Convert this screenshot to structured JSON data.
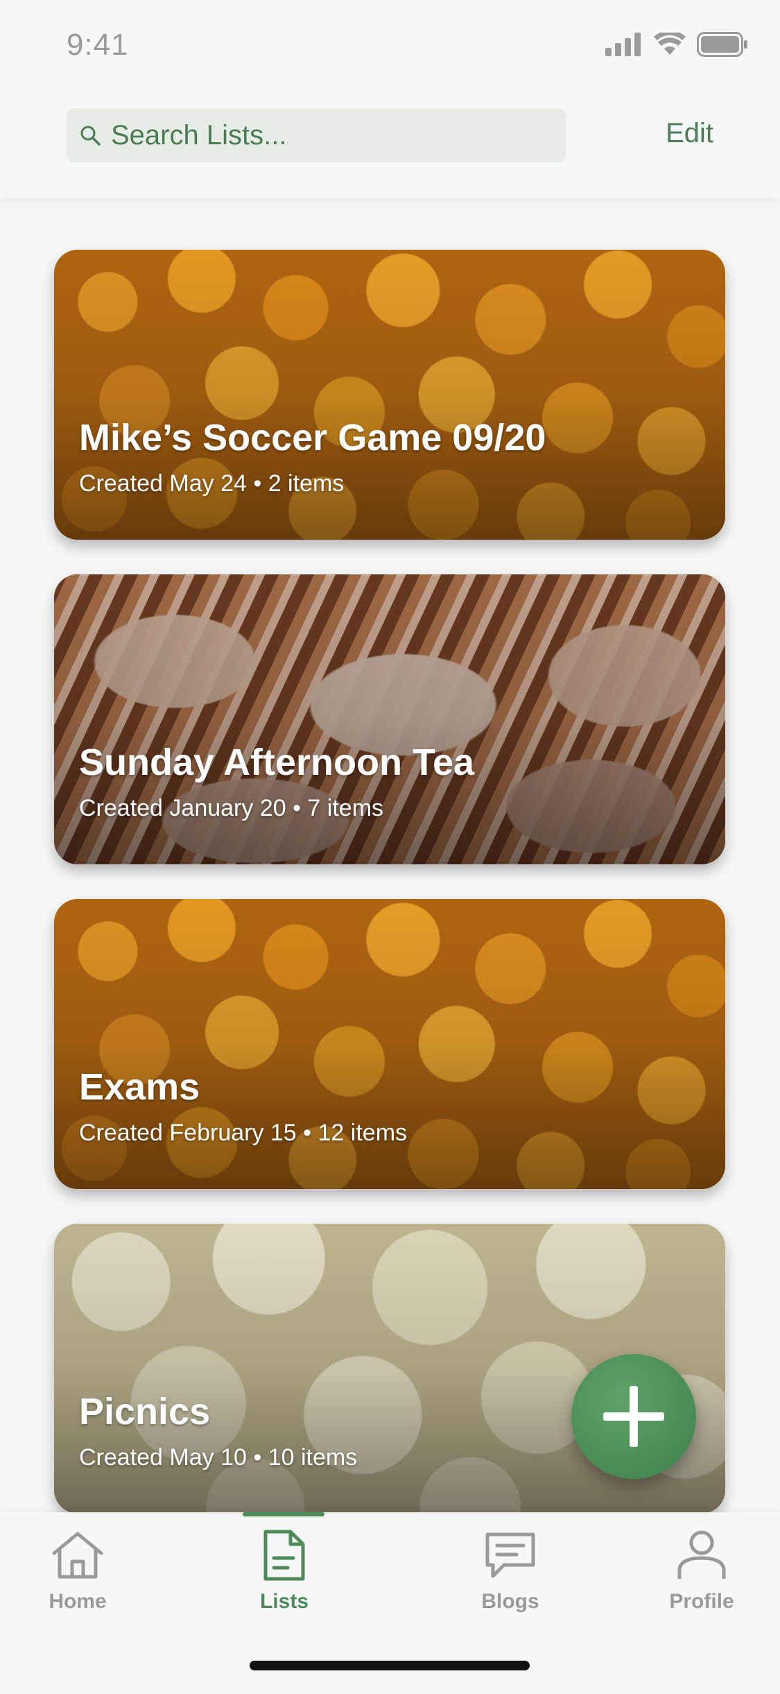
{
  "status": {
    "time": "9:41"
  },
  "header": {
    "search_placeholder": "Search Lists...",
    "edit_label": "Edit"
  },
  "lists": [
    {
      "title": "Mike’s Soccer Game 09/20",
      "subtitle": "Created May 24 • 2 items",
      "image": "apricots"
    },
    {
      "title": "Sunday Afternoon Tea",
      "subtitle": "Created January 20 • 7 items",
      "image": "croissants"
    },
    {
      "title": "Exams",
      "subtitle": "Created February 15 • 12 items",
      "image": "apricots"
    },
    {
      "title": "Picnics",
      "subtitle": "Created May 10 • 10 items",
      "image": "rice-cakes"
    }
  ],
  "fab": {
    "icon": "plus-icon"
  },
  "tabs": [
    {
      "label": "Home",
      "icon": "home-icon",
      "active": false
    },
    {
      "label": "Lists",
      "icon": "document-icon",
      "active": true
    },
    {
      "label": "Blogs",
      "icon": "chat-bubble-icon",
      "active": false
    },
    {
      "label": "Profile",
      "icon": "person-icon",
      "active": false
    }
  ],
  "colors": {
    "accent": "#4e8a5a",
    "search_bg": "#e6ede4",
    "inactive": "#9a9a9a"
  }
}
